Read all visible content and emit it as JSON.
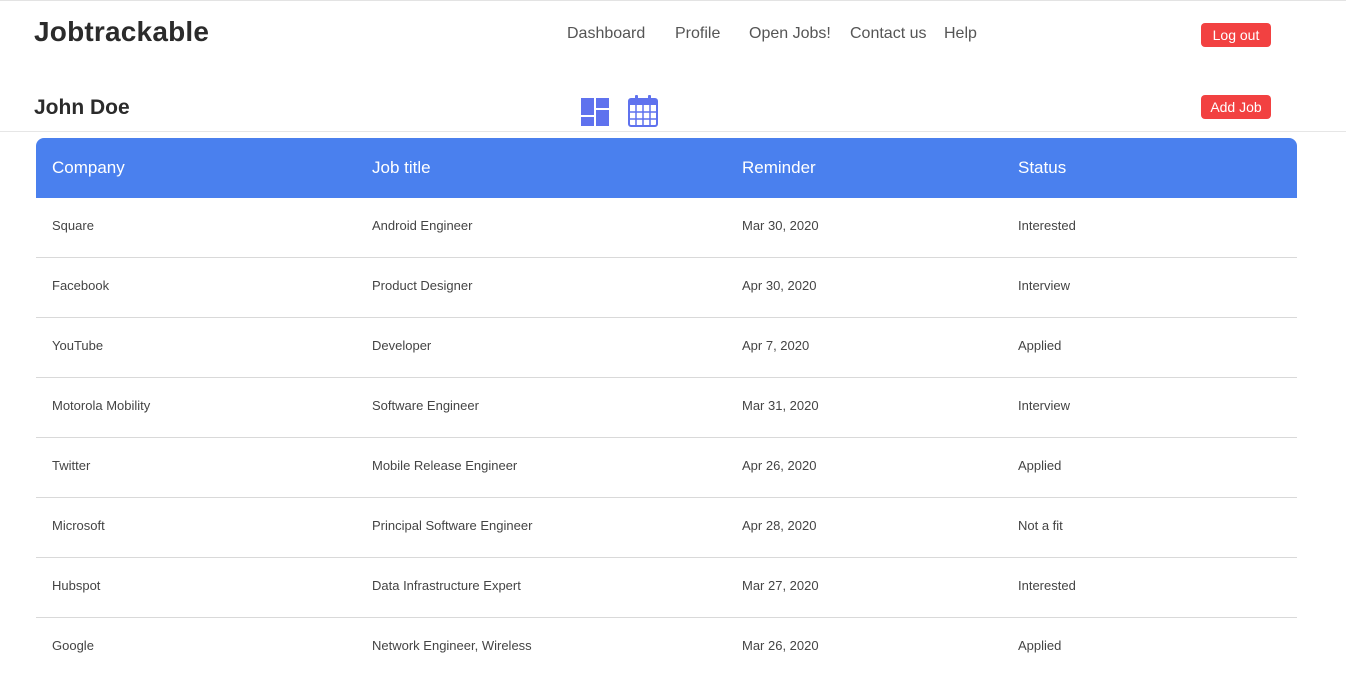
{
  "header": {
    "brand": "Jobtrackable",
    "nav": [
      "Dashboard",
      "Profile",
      "Open Jobs!",
      "Contact us",
      "Help"
    ],
    "logout_label": "Log out"
  },
  "toolbar": {
    "user_name": "John Doe",
    "add_job_label": "Add Job",
    "view_icons": [
      "dashboard-grid-icon",
      "calendar-icon"
    ]
  },
  "colors": {
    "accent": "#4a80ee",
    "button": "#f24141",
    "icon": "#5f72ee"
  },
  "table": {
    "columns": [
      "Company",
      "Job title",
      "Reminder",
      "Status"
    ],
    "rows": [
      [
        "Square",
        "Android Engineer",
        "Mar 30, 2020",
        "Interested"
      ],
      [
        "Facebook",
        "Product Designer",
        "Apr 30, 2020",
        "Interview"
      ],
      [
        "YouTube",
        "Developer",
        "Apr 7, 2020",
        "Applied"
      ],
      [
        "Motorola Mobility",
        "Software Engineer",
        "Mar 31, 2020",
        "Interview"
      ],
      [
        "Twitter",
        "Mobile Release Engineer",
        "Apr 26, 2020",
        "Applied"
      ],
      [
        "Microsoft",
        "Principal Software Engineer",
        "Apr 28, 2020",
        "Not a fit"
      ],
      [
        "Hubspot",
        "Data Infrastructure Expert",
        "Mar 27, 2020",
        "Interested"
      ],
      [
        "Google",
        "Network Engineer, Wireless",
        "Mar 26, 2020",
        "Applied"
      ]
    ]
  }
}
